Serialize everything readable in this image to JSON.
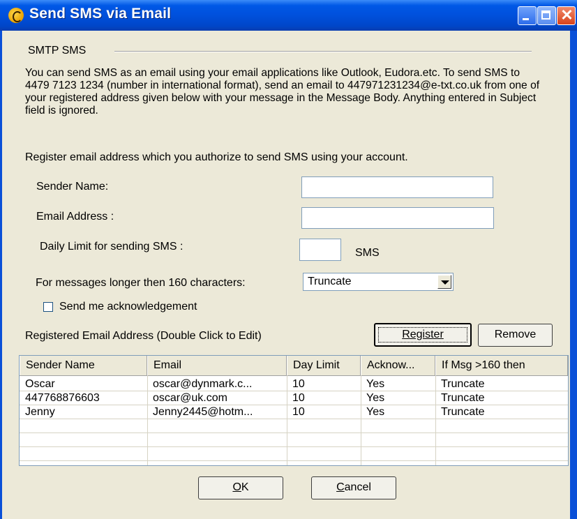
{
  "window": {
    "title": "Send SMS via Email",
    "titlebar_color": "#0050DC",
    "icons": [
      "app-icon",
      "minimize-icon",
      "maximize-icon",
      "close-icon"
    ]
  },
  "group": {
    "label": "SMTP SMS",
    "description": "You can send SMS as an email using your email applications like Outlook, Eudora.etc. To send SMS to 4479 7123 1234 (number in international format), send an email to 447971231234@e-txt.co.uk from one of your registered address given below with your message in the Message Body. Anything entered in Subject field is ignored."
  },
  "register_instructions": "Register email address which you authorize to send SMS  using your account.",
  "form": {
    "sender_name_label": "Sender Name:",
    "sender_name_value": "",
    "email_label": "Email Address :",
    "email_value": "",
    "daily_limit_label": "Daily Limit for sending SMS :",
    "daily_limit_value": "",
    "daily_limit_unit": "SMS",
    "long_message_label": "For messages longer then 160 characters:",
    "long_message_value": "Truncate",
    "acknowledge_label": "Send me acknowledgement",
    "acknowledge_checked": false
  },
  "registered": {
    "label": "Registered Email Address (Double Click to Edit)",
    "register_button": "Register",
    "remove_button": "Remove",
    "columns": [
      "Sender Name",
      "Email",
      "Day Limit",
      "Acknow...",
      "If Msg >160 then"
    ],
    "rows": [
      [
        "Oscar",
        "oscar@dynmark.c...",
        "10",
        "Yes",
        "Truncate"
      ],
      [
        "447768876603",
        "oscar@uk.com",
        "10",
        "Yes",
        "Truncate"
      ],
      [
        "Jenny",
        "Jenny2445@hotm...",
        "10",
        "Yes",
        "Truncate"
      ]
    ]
  },
  "footer": {
    "ok_prefix": "O",
    "ok_rest": "K",
    "cancel_prefix": "C",
    "cancel_rest": "ancel"
  }
}
